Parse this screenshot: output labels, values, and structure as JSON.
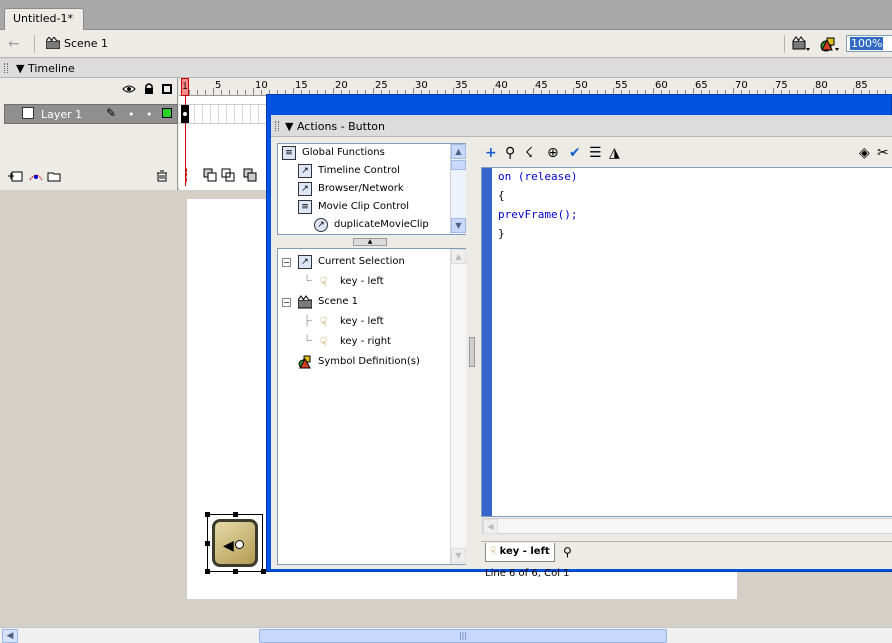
{
  "document": {
    "tab_title": "Untitled-1*"
  },
  "scene_bar": {
    "scene_label": "Scene 1",
    "zoom": "100%"
  },
  "timeline": {
    "title": "Timeline",
    "layer_name": "Layer 1",
    "layer_color": "#2bd12b",
    "ruler_numbers": [
      "1",
      "5",
      "10",
      "15",
      "20",
      "25",
      "30",
      "35",
      "40",
      "45",
      "50",
      "55",
      "60",
      "65",
      "70",
      "75",
      "80",
      "85"
    ],
    "current_frame": "1"
  },
  "actions": {
    "title": "Actions - Button",
    "toolbox": [
      {
        "label": "Global Functions",
        "icon": "book-icon",
        "indent": 0
      },
      {
        "label": "Timeline Control",
        "icon": "function-icon",
        "indent": 1
      },
      {
        "label": "Browser/Network",
        "icon": "function-icon",
        "indent": 1
      },
      {
        "label": "Movie Clip Control",
        "icon": "book-icon",
        "indent": 1
      },
      {
        "label": "duplicateMovieClip",
        "icon": "action-icon",
        "indent": 2
      }
    ],
    "navigator": [
      {
        "label": "Current Selection",
        "icon": "selection-icon",
        "indent": 0,
        "expander": "−"
      },
      {
        "label": "key - left",
        "icon": "button-symbol-icon",
        "indent": 1
      },
      {
        "label": "Scene 1",
        "icon": "scene-icon",
        "indent": 0,
        "expander": "−"
      },
      {
        "label": "key - left",
        "icon": "button-symbol-icon",
        "indent": 1
      },
      {
        "label": "key - right",
        "icon": "button-symbol-icon",
        "indent": 1
      },
      {
        "label": "Symbol Definition(s)",
        "icon": "symbol-definitions-icon",
        "indent": 0
      }
    ],
    "code_lines": [
      "on (release)",
      "{",
      "prevFrame();",
      "}"
    ],
    "script_tab": "key - left",
    "status": "Line 6 of 6, Col 1"
  },
  "colors": {
    "accent": "#0052e0",
    "gutter": "#3666cc",
    "selection": "#316ac5"
  }
}
